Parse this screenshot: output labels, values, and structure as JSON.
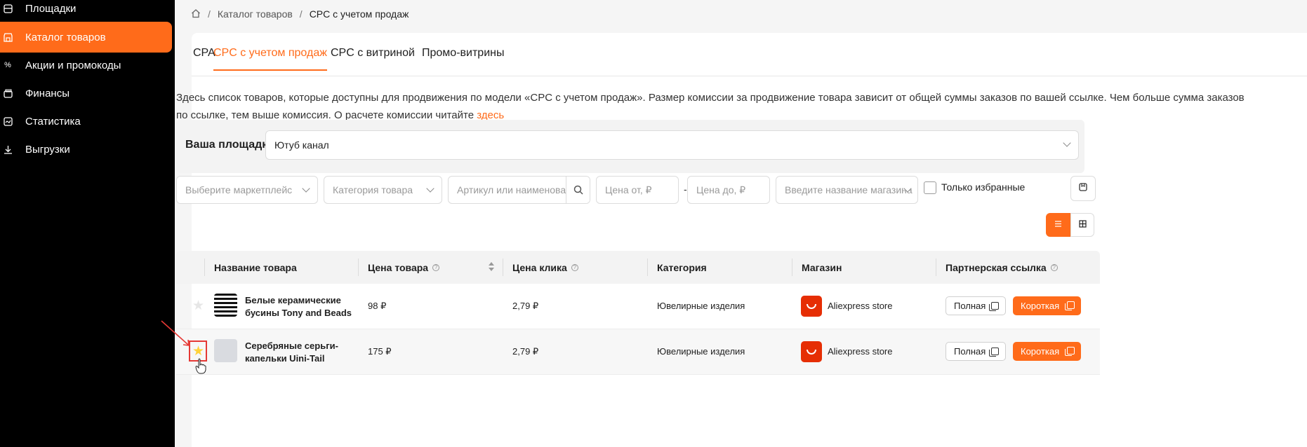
{
  "sidebar": {
    "items": [
      {
        "label": "Площадки",
        "icon": "building-icon",
        "active": false
      },
      {
        "label": "Каталог товаров",
        "icon": "store-icon",
        "active": true
      },
      {
        "label": "Акции и промокоды",
        "icon": "percent-icon",
        "active": false
      },
      {
        "label": "Финансы",
        "icon": "wallet-icon",
        "active": false
      },
      {
        "label": "Статистика",
        "icon": "chart-icon",
        "active": false
      },
      {
        "label": "Выгрузки",
        "icon": "download-icon",
        "active": false
      }
    ]
  },
  "breadcrumbs": {
    "home_icon": "home-icon",
    "items": [
      "Каталог товаров",
      "CPC с учетом продаж"
    ],
    "separator": "/"
  },
  "tabs": [
    {
      "label": "CPA",
      "active": false
    },
    {
      "label": "CPC с учетом продаж",
      "active": true
    },
    {
      "label": "CPC с витриной",
      "active": false
    },
    {
      "label": "Промо-витрины",
      "active": false
    }
  ],
  "description": {
    "text": "Здесь список товаров, которые доступны для продвижения по модели «CPC с учетом продаж». Размер комиссии за продвижение товара зависит от общей суммы заказов по вашей ссылке. Чем больше сумма заказов по ссылке, тем выше комиссия. О расчете комиссии читайте ",
    "link": "здесь"
  },
  "platform": {
    "label": "Ваша площадка",
    "value": "Ютуб канал"
  },
  "filters": {
    "marketplace_placeholder": "Выберите маркетплейс",
    "category_placeholder": "Категория товара",
    "search_placeholder": "Артикул или наименова...",
    "price_from_placeholder": "Цена от, ₽",
    "price_to_placeholder": "Цена до, ₽",
    "shop_placeholder": "Введите название магазина",
    "dash": "-",
    "favorites_label": "Только избранные",
    "favorites_checked": false
  },
  "table": {
    "headers": {
      "name": "Название товара",
      "price": "Цена товара",
      "click_price": "Цена клика",
      "category": "Категория",
      "shop": "Магазин",
      "link": "Партнерская ссылка"
    },
    "rows": [
      {
        "favorite": false,
        "name": "Белые керамические бусины Tony and Beads",
        "price": "98 ₽",
        "click_price": "2,79 ₽",
        "category": "Ювелирные изделия",
        "shop": "Aliexpress store",
        "full_label": "Полная",
        "short_label": "Короткая"
      },
      {
        "favorite": true,
        "name": "Серебряные серьги-капельки Uini-Tail",
        "price": "175 ₽",
        "click_price": "2,79 ₽",
        "category": "Ювелирные изделия",
        "shop": "Aliexpress store",
        "full_label": "Полная",
        "short_label": "Короткая"
      }
    ]
  },
  "colors": {
    "accent": "#ff6b1a",
    "sidebar_bg": "#000000",
    "favorite_star": "#ffd23a",
    "annotation": "#e53935"
  }
}
